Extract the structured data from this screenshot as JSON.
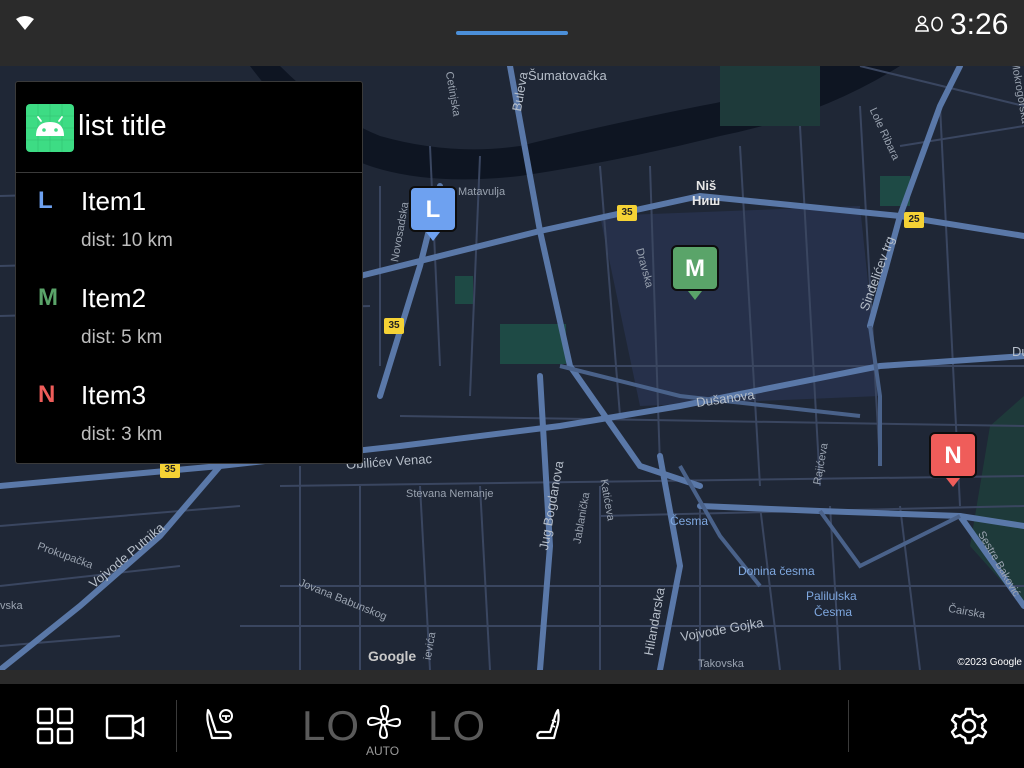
{
  "status_bar": {
    "time": "3:26",
    "wifi_icon": "wifi-icon",
    "profile_icon": "profile-icon"
  },
  "panel": {
    "title": "list title",
    "app_icon": "android-icon",
    "items": [
      {
        "letter": "L",
        "title": "Item1",
        "subtitle": "dist: 10 km",
        "color": "#6ea1f0"
      },
      {
        "letter": "M",
        "title": "Item2",
        "subtitle": "dist: 5 km",
        "color": "#5aa469"
      },
      {
        "letter": "N",
        "title": "Item3",
        "subtitle": "dist: 3 km",
        "color": "#ef5d5a"
      }
    ]
  },
  "map": {
    "markers": [
      {
        "letter": "L",
        "color": "#6ea1f0"
      },
      {
        "letter": "M",
        "color": "#5aa469"
      },
      {
        "letter": "N",
        "color": "#ef5d5a"
      }
    ],
    "city_name_latin": "Niš",
    "city_name_cyrillic": "Ниш",
    "streets": {
      "sumatovacka": "Šumatovačka",
      "bulevar": "Buleva",
      "cetinjska": "Cetinjska",
      "matavulja": "Matavulja",
      "novosadska": "Novosadska",
      "dravska": "Dravska",
      "lole_ribara": "Lole Ribara",
      "sindjelicev_trg": "Sinđelićev trg",
      "dusanova": "Dušanova",
      "dusanova_right": "Dušan",
      "obilicev_venac": "Obilićev Venac",
      "stevana_nemanje": "Stevana Nemanje",
      "jug_bogdanova": "Jug Bogdanova",
      "jablanicka": "Jablanička",
      "katiceva": "Katićeva",
      "vojvode_putnika": "Vojvode Putnika",
      "prokupacka": "Prokupačka",
      "jovana_babunskog": "Jovana Babunskog",
      "hilandarska": "Hilandarska",
      "vojvode_gojka": "Vojvode Gojka",
      "takovska": "Takovska",
      "rajiceva": "Rajićeva",
      "cairska": "Čairska",
      "sestre_bakovic": "Sestre Baković",
      "mokrogorska": "Mokrogorska",
      "vlaska": "vska",
      "kosovke": "ievića"
    },
    "districts": {
      "cesma": "Česma",
      "donina_cesma": "Donina česma",
      "palilulska_cesma_1": "Palilulska",
      "palilulska_cesma_2": "Česma"
    },
    "road_numbers": [
      "35",
      "35",
      "35",
      "25"
    ],
    "logo": "Google",
    "copyright": "©2023 Google"
  },
  "bottom_bar": {
    "apps_icon": "apps-grid-icon",
    "camera_icon": "video-camera-icon",
    "seat_driver_icon": "seat-heat-driver-icon",
    "temp_left": "LO",
    "fan_icon": "fan-icon",
    "fan_label": "AUTO",
    "temp_right": "LO",
    "seat_passenger_icon": "seat-passenger-icon",
    "settings_icon": "gear-icon"
  }
}
